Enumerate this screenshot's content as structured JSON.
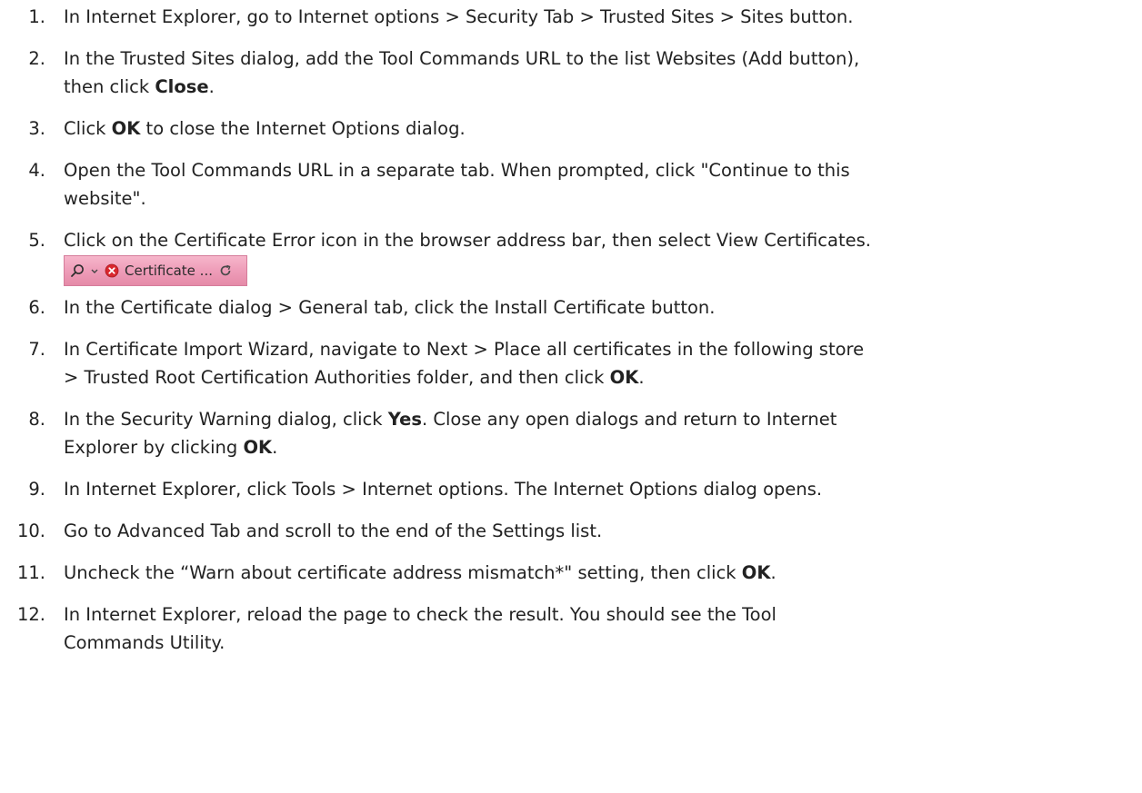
{
  "steps": [
    {
      "num": "1.",
      "lines": [
        [
          {
            "t": "In Internet Explorer, go to Internet options > Security Tab > Trusted Sites > Sites button."
          }
        ]
      ]
    },
    {
      "num": "2.",
      "lines": [
        [
          {
            "t": "In the Trusted Sites dialog, add the Tool Commands URL to the list Websites (Add button),"
          }
        ],
        [
          {
            "t": "then click "
          },
          {
            "b": "Close"
          },
          {
            "t": "."
          }
        ]
      ]
    },
    {
      "num": "3.",
      "lines": [
        [
          {
            "t": "Click "
          },
          {
            "b": "OK"
          },
          {
            "t": " to close the Internet Options dialog."
          }
        ]
      ]
    },
    {
      "num": "4.",
      "lines": [
        [
          {
            "t": "Open the Tool Commands URL in a separate tab. When prompted, click \"Continue to this"
          }
        ],
        [
          {
            "t": "website\"."
          }
        ]
      ]
    },
    {
      "num": "5.",
      "lines": [
        [
          {
            "t": "Click on the Certificate Error icon in the browser address bar, then select View Certificates."
          }
        ]
      ],
      "addressbar": {
        "label": "Certificate ...",
        "icons": [
          "search-icon",
          "chevron-down-icon",
          "error-icon",
          "refresh-icon"
        ],
        "error_color": "#d9272e"
      }
    },
    {
      "num": "6.",
      "lines": [
        [
          {
            "t": "In the Certificate dialog > General tab, click the Install Certificate button."
          }
        ]
      ]
    },
    {
      "num": "7.",
      "lines": [
        [
          {
            "t": "In Certificate Import Wizard, navigate to Next > Place all certificates in the following store"
          }
        ],
        [
          {
            "t": "> Trusted Root Certification Authorities folder, and then click "
          },
          {
            "b": "OK"
          },
          {
            "t": "."
          }
        ]
      ]
    },
    {
      "num": "8.",
      "lines": [
        [
          {
            "t": "In the Security Warning dialog, click "
          },
          {
            "b": "Yes"
          },
          {
            "t": ". Close any open dialogs and return to Internet"
          }
        ],
        [
          {
            "t": "Explorer by clicking "
          },
          {
            "b": "OK"
          },
          {
            "t": "."
          }
        ]
      ]
    },
    {
      "num": "9.",
      "lines": [
        [
          {
            "t": "In Internet Explorer, click Tools > Internet options. The Internet Options dialog opens."
          }
        ]
      ]
    },
    {
      "num": "10.",
      "lines": [
        [
          {
            "t": "Go to Advanced Tab and scroll to the end of the Settings list."
          }
        ]
      ]
    },
    {
      "num": "11.",
      "lines": [
        [
          {
            "t": "Uncheck the “Warn about certificate address mismatch*\" setting, then click "
          },
          {
            "b": "OK"
          },
          {
            "t": "."
          }
        ]
      ]
    },
    {
      "num": "12.",
      "lines": [
        [
          {
            "t": "In Internet Explorer, reload the page to check the result. You should see the Tool"
          }
        ],
        [
          {
            "t": "Commands Utility."
          }
        ]
      ]
    }
  ]
}
